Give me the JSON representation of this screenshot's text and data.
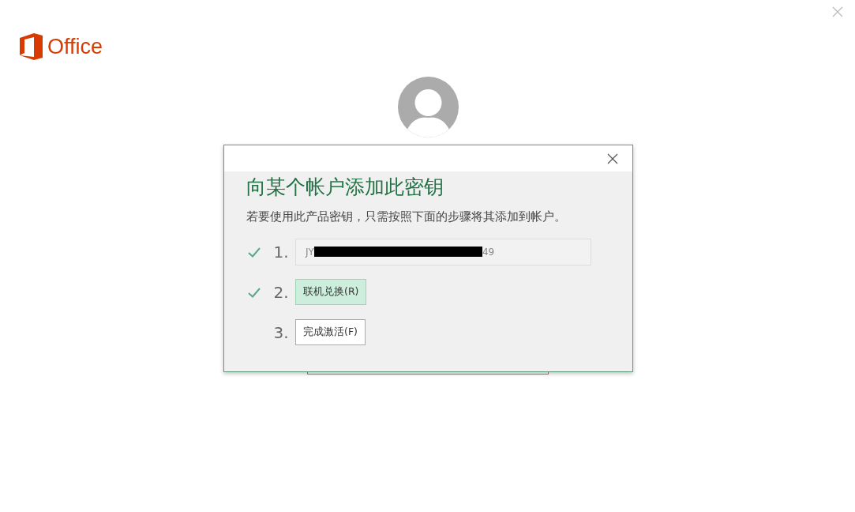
{
  "app": {
    "logo_text": "Office"
  },
  "dialog": {
    "title": "向某个帐户添加此密钥",
    "description": "若要使用此产品密钥，只需按照下面的步骤将其添加到帐户。",
    "steps": [
      {
        "kind": "field",
        "number": "1.",
        "done": true,
        "value_prefix": "JY",
        "redacted": true,
        "value_suffix": "49"
      },
      {
        "kind": "button",
        "number": "2.",
        "done": true,
        "label": "联机兑换(R)",
        "selected": true
      },
      {
        "kind": "button",
        "number": "3.",
        "done": false,
        "label": "完成激活(F)",
        "selected": false
      }
    ]
  }
}
